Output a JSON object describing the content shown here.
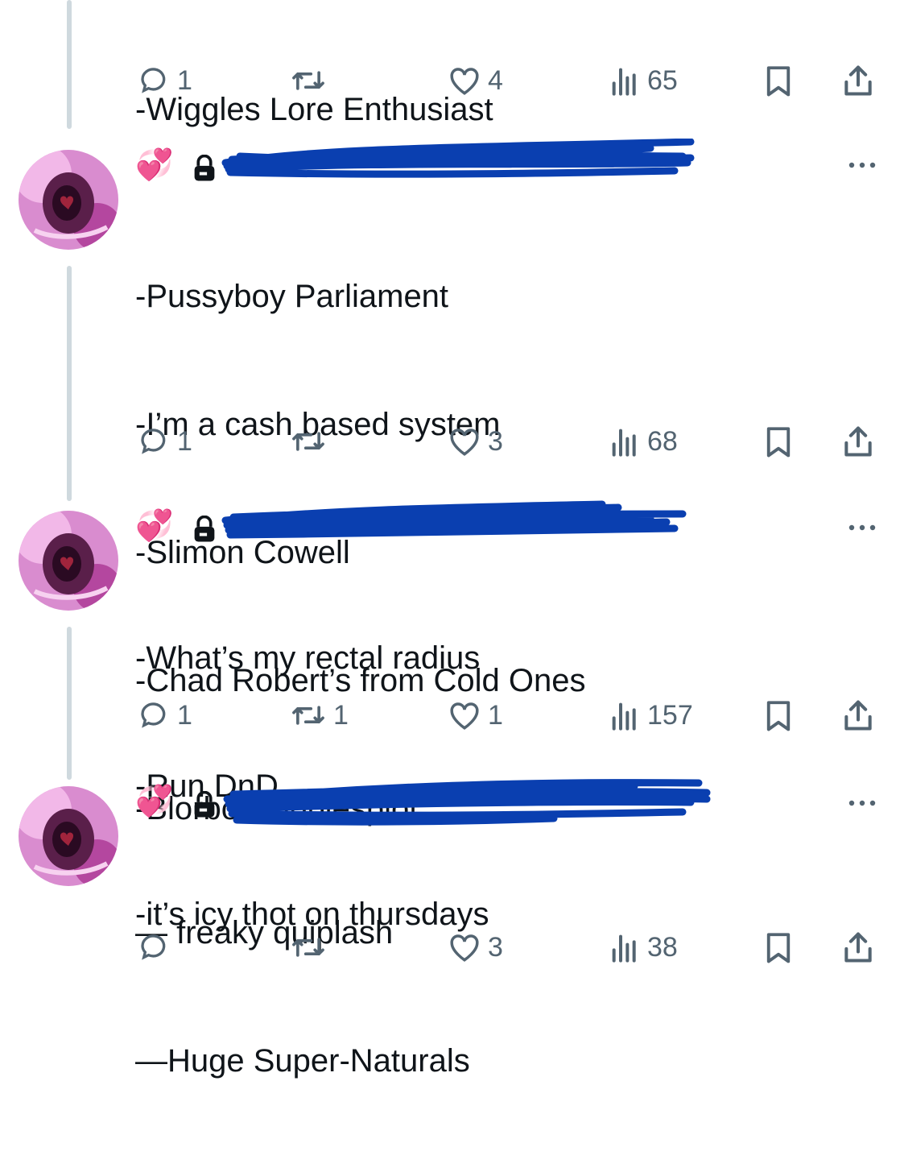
{
  "tweets": [
    {
      "lines": [
        "-Wiggles Lore Enthusiast"
      ],
      "stats": {
        "replies": "1",
        "retweets": "",
        "likes": "4",
        "views": "65"
      }
    },
    {
      "emoji": "💞",
      "lines": [
        "-Pussyboy Parliament",
        "-I’m a cash based system",
        "-Slimon Cowell",
        "-Chad Robert’s from Cold Ones",
        "-Blorbo Cobblesplot"
      ],
      "stats": {
        "replies": "1",
        "retweets": "",
        "likes": "3",
        "views": "68"
      }
    },
    {
      "emoji": "💞",
      "lines": [
        "-What’s my rectal radius",
        "-Run DnD",
        "-it’s icy thot on thursdays"
      ],
      "stats": {
        "replies": "1",
        "retweets": "1",
        "likes": "1",
        "views": "157"
      }
    },
    {
      "emoji": "💞",
      "lines": [
        "— freaky quiplash",
        "—Huge Super-Naturals"
      ],
      "stats": {
        "replies": "",
        "retweets": "",
        "likes": "3",
        "views": "38"
      }
    }
  ],
  "icons": {
    "reply": "reply-icon",
    "retweet": "retweet-icon",
    "like": "heart-icon",
    "views": "views-icon",
    "bookmark": "bookmark-icon",
    "share": "share-icon",
    "more": "more-icon",
    "lock": "lock-icon"
  },
  "colors": {
    "text": "#0f1419",
    "icon": "#536471",
    "thread": "#cfd9de",
    "redaction": "#0a3fb0"
  }
}
